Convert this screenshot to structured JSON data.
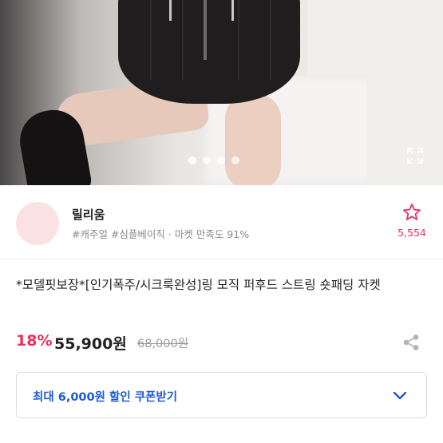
{
  "product_image": {
    "total_images": 4,
    "active_index": 0
  },
  "seller": {
    "name": "릴리움",
    "tags": "#캐주얼 #심플베이직 · 마켓 만족도 91%",
    "favorite_count": "5,554"
  },
  "product": {
    "title": "*모델핏보장*[인기폭주/시크룩완성]링 모직 퍼후드 스트링  숏패딩 자켓",
    "discount": "18%",
    "price": "55,900원",
    "original_price": "68,000원"
  },
  "coupon": {
    "label": "최대 6,000원 할인 쿠폰받기"
  },
  "icons": {
    "favorite": "star-outline-icon",
    "share": "share-icon",
    "expand": "expand-icon",
    "chevron": "chevron-down-icon"
  },
  "colors": {
    "accent_pink": "#ef2d5c",
    "coupon_blue": "#1e5ad6",
    "avatar_bg": "#fbe2e2"
  }
}
